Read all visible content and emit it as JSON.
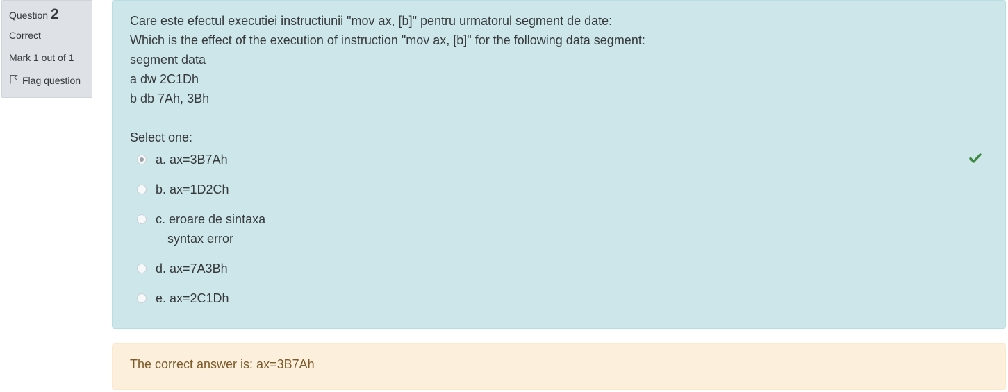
{
  "info": {
    "question_label": "Question",
    "question_number": "2",
    "state": "Correct",
    "grade": "Mark 1 out of 1",
    "flag_label": "Flag question"
  },
  "question": {
    "lines": [
      "Care este efectul executiei instructiunii \"mov ax, [b]\" pentru urmatorul segment de date:",
      "Which is the effect of the execution of instruction \"mov ax, [b]\" for the following data segment:",
      "segment data",
      "a dw 2C1Dh",
      "b db 7Ah, 3Bh"
    ],
    "prompt": "Select one:",
    "answers": [
      {
        "label": "a. ax=3B7Ah",
        "selected": true
      },
      {
        "label": "b. ax=1D2Ch",
        "selected": false
      },
      {
        "label": "c. eroare de sintaxa",
        "label_line2": "syntax error",
        "selected": false
      },
      {
        "label": "d. ax=7A3Bh",
        "selected": false
      },
      {
        "label": "e. ax=2C1Dh",
        "selected": false
      }
    ]
  },
  "feedback": {
    "right_answer": "The correct answer is: ax=3B7Ah"
  },
  "icons": {
    "flag": "flag-icon",
    "correct": "check-icon"
  },
  "colors": {
    "info_bg": "#dee2e6",
    "question_bg": "#cce6ea",
    "feedback_bg": "#fcefdc",
    "feedback_text": "#7d5a29",
    "check": "#3e8740"
  }
}
